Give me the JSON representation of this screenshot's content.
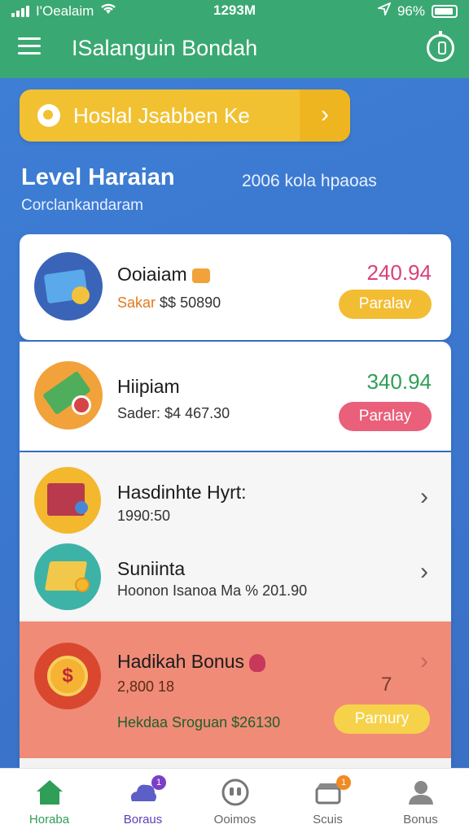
{
  "status_bar": {
    "carrier": "I'Oealaim",
    "time": "1293M",
    "battery": "96%"
  },
  "header": {
    "title": "ISalanguin Bondah"
  },
  "banner": {
    "text": "Hoslal Jsabben Ke"
  },
  "level": {
    "title": "Level Haraian",
    "subtitle": "Corclankandaram",
    "right_text": "2006 kola hpaoas"
  },
  "cards": [
    {
      "title": "Ooiaiam",
      "sub_label": "Sakar",
      "sub_value": "$$ 50890",
      "amount": "240.94",
      "button": "Paralav"
    },
    {
      "title": "Hiipiam",
      "sub_label": "Sader:",
      "sub_value": "$4 467.30",
      "amount": "340.94",
      "button": "Paralay"
    },
    {
      "title": "Hasdinhte Hyrt:",
      "sub": "1990:50"
    },
    {
      "title": "Suniinta",
      "sub": "Hoonon Isanoa Ma % 201.90"
    },
    {
      "title": "Hadikah Bonus",
      "sub": "2,800 18",
      "extra": "Hekdaa Sroguan $26130",
      "marker": "7",
      "button": "Parnury"
    }
  ],
  "colors": {
    "header": "#3aa872",
    "background": "#3b78d0",
    "amount_pink": "#d9417a",
    "amount_green": "#2f9e57",
    "pill_yellow": "#f2bd33",
    "pill_pink": "#ea5f7a",
    "bonus_card": "#f08b78"
  },
  "bottom_nav": [
    {
      "label": "Horaba",
      "icon": "home-icon",
      "badge": ""
    },
    {
      "label": "Boraus",
      "icon": "cloud-icon",
      "badge": "1"
    },
    {
      "label": "Ooimos",
      "icon": "contacts-icon",
      "badge": ""
    },
    {
      "label": "Scuis",
      "icon": "gift-icon",
      "badge": "1"
    },
    {
      "label": "Bonus",
      "icon": "profile-icon",
      "badge": ""
    }
  ]
}
